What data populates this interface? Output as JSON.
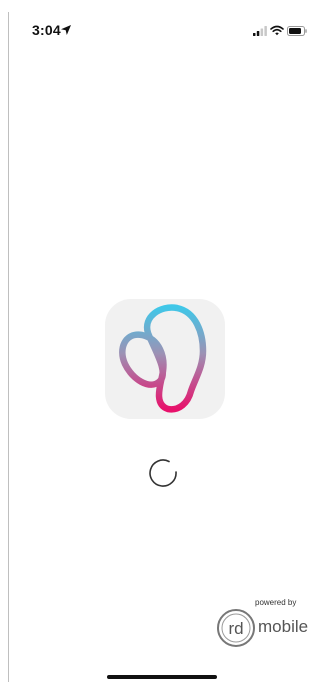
{
  "status_bar": {
    "time": "3:04",
    "icons": [
      "location-arrow-icon",
      "cellular-signal-icon",
      "wifi-icon",
      "battery-icon"
    ]
  },
  "splash": {
    "app_icon": "app-logo-icon",
    "loading_indicator": "spinner-icon"
  },
  "branding": {
    "powered_by": "powered by",
    "logo_mark": "rd",
    "logo_name": "mobile"
  },
  "colors": {
    "background": "#ffffff",
    "icon_tile": "#f1f1f1",
    "logo_gradient_top": "#40c7e8",
    "logo_gradient_mid": "#9c92b5",
    "logo_gradient_bottom": "#e8116b"
  }
}
